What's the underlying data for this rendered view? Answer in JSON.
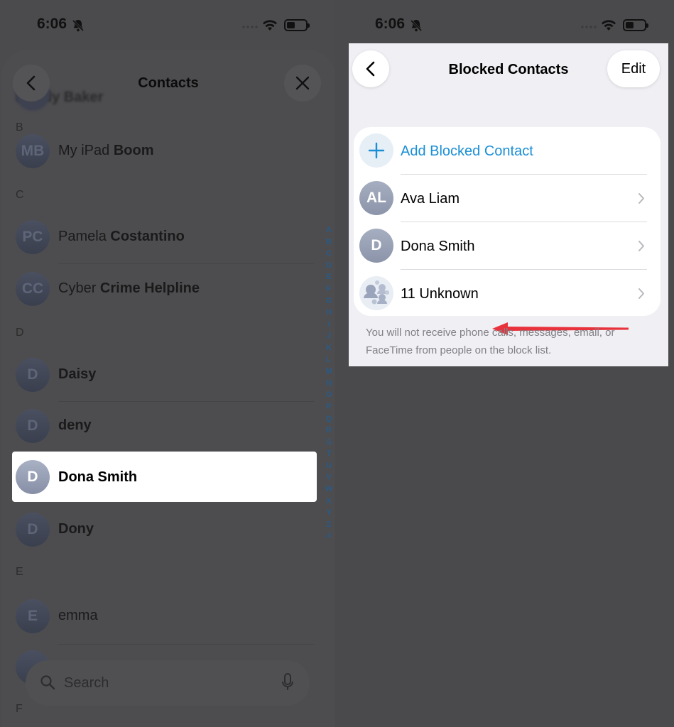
{
  "status": {
    "time": "6:06"
  },
  "left": {
    "title": "Contacts",
    "ghost_name": "Boddy Baker",
    "sections": [
      {
        "letter": "B",
        "rows": [
          {
            "initials": "MB",
            "first": "My iPad",
            "last": "Boom"
          }
        ]
      },
      {
        "letter": "C",
        "rows": [
          {
            "initials": "PC",
            "first": "Pamela",
            "last": "Costantino"
          },
          {
            "initials": "CC",
            "first": "Cyber",
            "last": "Crime Helpline"
          }
        ]
      },
      {
        "letter": "D",
        "rows": [
          {
            "initials": "D",
            "first": "",
            "last": "Daisy"
          },
          {
            "initials": "D",
            "first": "",
            "last": "deny"
          },
          {
            "initials": "D",
            "first": "",
            "last": "Dona Smith"
          },
          {
            "initials": "D",
            "first": "",
            "last": "Dony"
          }
        ]
      },
      {
        "letter": "E",
        "rows": [
          {
            "initials": "E",
            "first": "",
            "last": "emma"
          }
        ]
      },
      {
        "letter": "F",
        "rows": []
      }
    ],
    "highlighted": {
      "initials": "D",
      "name": "Dona Smith"
    },
    "index_letters": [
      "A",
      "B",
      "C",
      "D",
      "E",
      "F",
      "G",
      "H",
      "I",
      "J",
      "K",
      "L",
      "M",
      "N",
      "O",
      "P",
      "Q",
      "R",
      "S",
      "T",
      "U",
      "V",
      "W",
      "X",
      "Y",
      "Z",
      "#"
    ],
    "search_placeholder": "Search"
  },
  "right": {
    "title": "Blocked Contacts",
    "edit_label": "Edit",
    "add_label": "Add Blocked Contact",
    "blocked": [
      {
        "initials": "AL",
        "name": "Ava Liam"
      },
      {
        "initials": "D",
        "name": "Dona Smith"
      },
      {
        "initials": "",
        "name": "11 Unknown"
      }
    ],
    "footer": "You will not receive phone calls, messages, email, or FaceTime from people on the block list.",
    "colors": {
      "accent": "#1a8fd6",
      "arrow": "#e8323c"
    }
  }
}
